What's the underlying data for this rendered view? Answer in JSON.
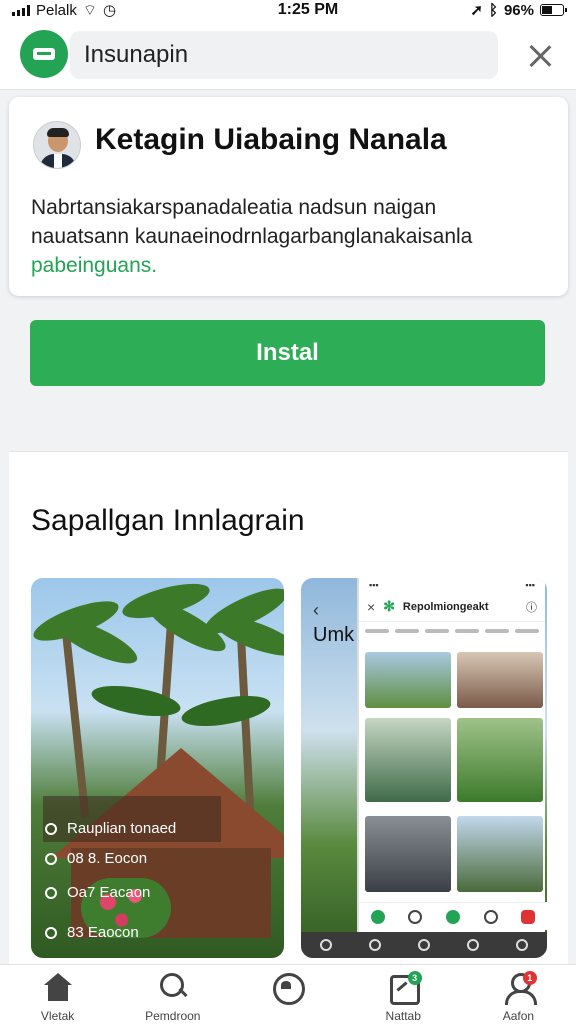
{
  "status_bar": {
    "carrier": "Pelalk",
    "time": "1:25 PM",
    "battery": "96%"
  },
  "top_bar": {
    "search_value": "Insunapin",
    "logo_icon": "app-logo-icon",
    "close_icon": "close-icon"
  },
  "app": {
    "name": "Ketagin Uiabaing Nanala",
    "description_line1": "Nabrtansiakarspanadaleatia nadsun naigan",
    "description_line2": "nauatsann kaunaeinodrnlagarbanglanakaisanla",
    "description_link": "pabeinguans."
  },
  "install": {
    "label": "Instal",
    "color": "#2ead57"
  },
  "screenshots": {
    "title": "Sapallgan Innlagrain",
    "shot1": {
      "overlay_title": "Rauplian tonaed",
      "row1": "08 8. Eocon",
      "row2": "Oa7 Eacaon",
      "row3": "83 Eaocon"
    },
    "shot2": {
      "partial_text": "Umk",
      "phone_title": "Repolmiongeakt"
    }
  },
  "bottom_nav": {
    "items": [
      {
        "label": "Vletak",
        "icon": "home-icon"
      },
      {
        "label": "Pemdroon",
        "icon": "search-icon"
      },
      {
        "label": "",
        "icon": "chat-icon"
      },
      {
        "label": "Nattab",
        "icon": "update-icon",
        "badge": "3",
        "badge_color": "#23a455"
      },
      {
        "label": "Aafon",
        "icon": "profile-icon",
        "badge": "1",
        "badge_color": "#e03434"
      }
    ]
  },
  "colors": {
    "accent": "#23a455",
    "alert": "#e03434"
  }
}
